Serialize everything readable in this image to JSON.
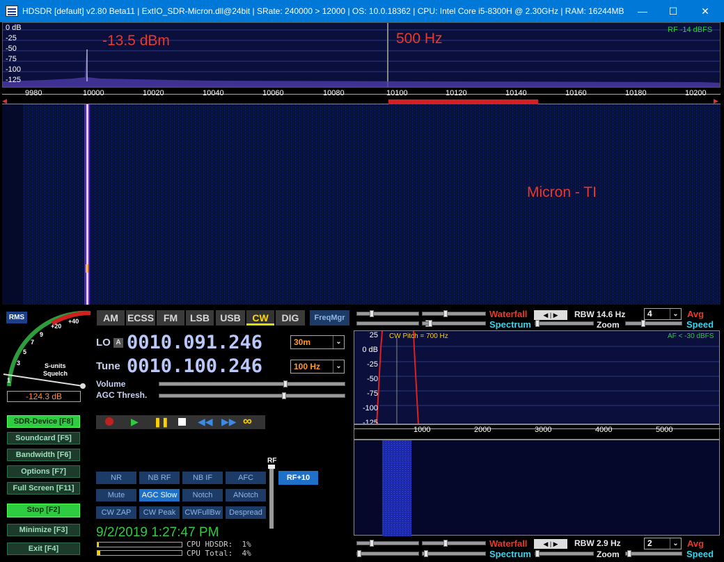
{
  "window": {
    "title": "HDSDR  [default]  v2.80 Beta11  |  ExtIO_SDR-Micron.dll@24bit  |  SRate: 240000 > 12000  |  OS: 10.0.18362  |  CPU: Intel Core i5-8300H @ 2.30GHz  |  RAM: 16244MB",
    "minimize": "—",
    "maximize": "☐",
    "close": "✕"
  },
  "spectrum": {
    "db_labels": [
      "0 dB",
      "-25",
      "-50",
      "-75",
      "-100",
      "-125"
    ],
    "rf_status": "RF  -14 dBFS",
    "annot_level": "-13.5 dBm",
    "annot_bw": "500 Hz",
    "freq_ticks": [
      "9980",
      "10000",
      "10020",
      "10040",
      "10060",
      "10080",
      "10100",
      "10120",
      "10140",
      "10160",
      "10180",
      "10200"
    ]
  },
  "waterfall": {
    "annot": "Micron - TI"
  },
  "smeter": {
    "rms": "RMS",
    "scale": [
      "1",
      "3",
      "5",
      "7",
      "9",
      "+20",
      "+40"
    ],
    "caption1": "S-units",
    "caption2": "Squelch",
    "reading": "-124.3 dB"
  },
  "modes": [
    "AM",
    "ECSS",
    "FM",
    "LSB",
    "USB",
    "CW",
    "DIG"
  ],
  "active_mode": "CW",
  "freqmgr": "FreqMgr",
  "lo": {
    "label": "LO",
    "badge": "A",
    "value": "0010.091.246",
    "band": "30m"
  },
  "tune": {
    "label": "Tune",
    "value": "0010.100.246",
    "step": "100 Hz"
  },
  "sliders": {
    "volume": "Volume",
    "agc": "AGC Thresh."
  },
  "side_buttons": [
    {
      "label": "SDR-Device [F8]"
    },
    {
      "label": "Soundcard  [F5]"
    },
    {
      "label": "Bandwidth  [F6]"
    },
    {
      "label": "Options    [F7]"
    },
    {
      "label": "Full Screen [F11]"
    },
    {
      "label": "Stop         [F2]"
    },
    {
      "label": "Minimize   [F3]"
    },
    {
      "label": "Exit        [F4]"
    }
  ],
  "dsp": [
    [
      "NR",
      "NB RF",
      "NB IF",
      "AFC"
    ],
    [
      "Mute",
      "AGC Slow",
      "Notch",
      "ANotch"
    ],
    [
      "CW ZAP",
      "CW Peak",
      "CWFullBw",
      "Despread"
    ]
  ],
  "rf_label": "RF",
  "rf10": "RF+10",
  "clock": "9/2/2019 1:27:47 PM",
  "cpu_hdsdr": "CPU HDSDR:  1%",
  "cpu_total": "CPU Total:  4%",
  "top_ctrl": {
    "waterfall": "Waterfall",
    "spectrum": "Spectrum",
    "rbw": "RBW  14.6 Hz",
    "zoom": "Zoom",
    "avg_value": "4",
    "avg": "Avg",
    "speed": "Speed"
  },
  "af": {
    "db_labels": [
      "25",
      "0 dB",
      "-25",
      "-50",
      "-75",
      "-100",
      "-125"
    ],
    "pitch": "CW Pitch = 700 Hz",
    "status": "AF < -30 dBFS",
    "ticks": [
      "1000",
      "2000",
      "3000",
      "4000",
      "5000"
    ]
  },
  "bottom_ctrl": {
    "waterfall": "Waterfall",
    "spectrum": "Spectrum",
    "rbw": "RBW   2.9 Hz",
    "zoom": "Zoom",
    "avg_value": "2",
    "avg": "Avg",
    "speed": "Speed"
  },
  "colors": {
    "titlebar": "#0078d7",
    "accent_red": "#e8392a",
    "active_green": "#2ecc40",
    "dsp_blue": "#1c3b66"
  }
}
